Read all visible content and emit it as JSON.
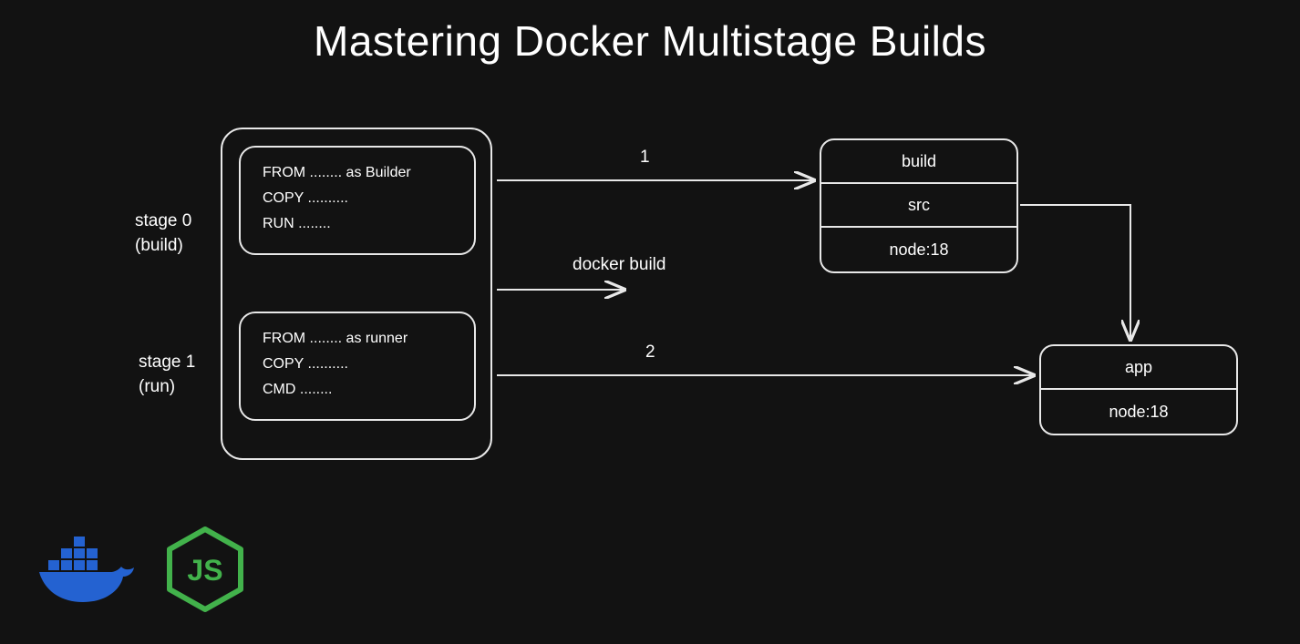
{
  "title": "Mastering Docker Multistage Builds",
  "stages": {
    "stage0": {
      "label_line1": "stage 0",
      "label_line2": "(build)",
      "code": [
        "FROM ........ as Builder",
        "COPY ..........",
        "RUN ........"
      ]
    },
    "stage1": {
      "label_line1": "stage 1",
      "label_line2": "(run)",
      "code": [
        "FROM ........ as runner",
        "COPY ..........",
        "CMD ........"
      ]
    }
  },
  "arrows": {
    "one": "1",
    "docker_build": "docker build",
    "two": "2"
  },
  "build_stack": {
    "rows": [
      "build",
      "src",
      "node:18"
    ]
  },
  "app_stack": {
    "rows": [
      "app",
      "node:18"
    ]
  },
  "logos": {
    "docker": "docker-icon",
    "node": "nodejs-icon"
  },
  "colors": {
    "background": "#121212",
    "stroke": "#e8e8e8",
    "docker_blue": "#2462d1",
    "node_green": "#42b24b"
  }
}
